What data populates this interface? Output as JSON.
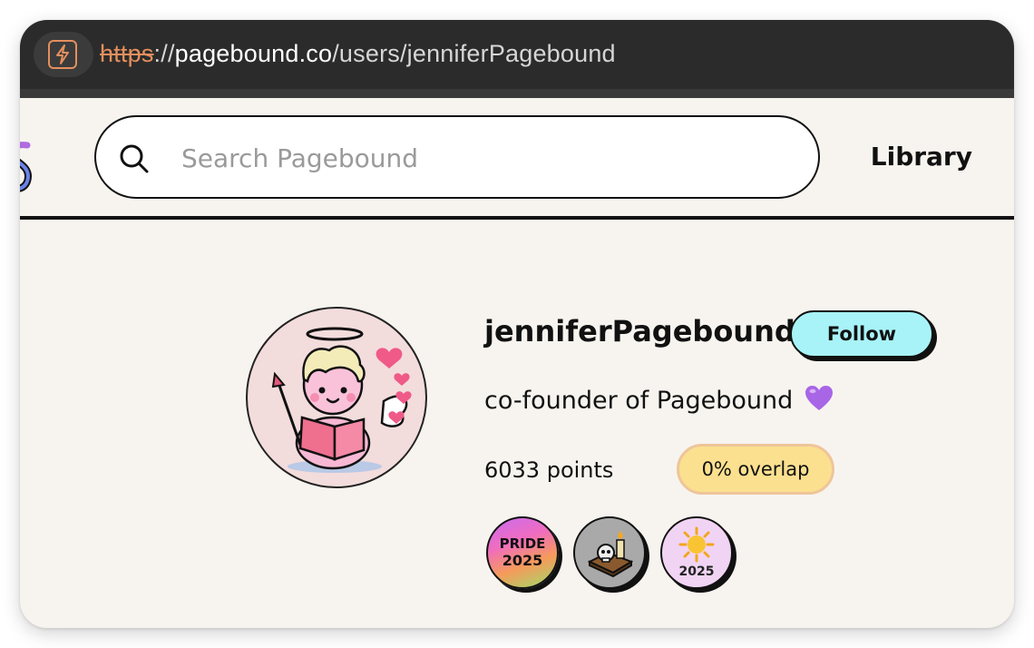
{
  "browser": {
    "url_scheme": "https",
    "url_separator": "://",
    "url_host": "pagebound.co",
    "url_path": "/users/jenniferPagebound",
    "site_icon": "lightning-bolt-icon"
  },
  "header": {
    "search_placeholder": "Search Pagebound",
    "library_label": "Library"
  },
  "profile": {
    "username": "jenniferPagebound",
    "follow_label": "Follow",
    "bio": "co-founder of Pagebound",
    "bio_emoji": "purple-heart-icon",
    "points_label": "6033 points",
    "overlap_label": "0% overlap",
    "badges": [
      {
        "name": "pride-2025-badge",
        "title": "PRIDE",
        "year": "2025"
      },
      {
        "name": "skull-book-badge"
      },
      {
        "name": "sun-2025-badge",
        "year": "2025"
      }
    ]
  },
  "colors": {
    "page_bg": "#f7f4ef",
    "follow_bg": "#a8f3f8",
    "overlap_bg": "#fbe08f",
    "url_scheme": "#e48f5e",
    "urlbar_bg": "#2b2b2b"
  }
}
